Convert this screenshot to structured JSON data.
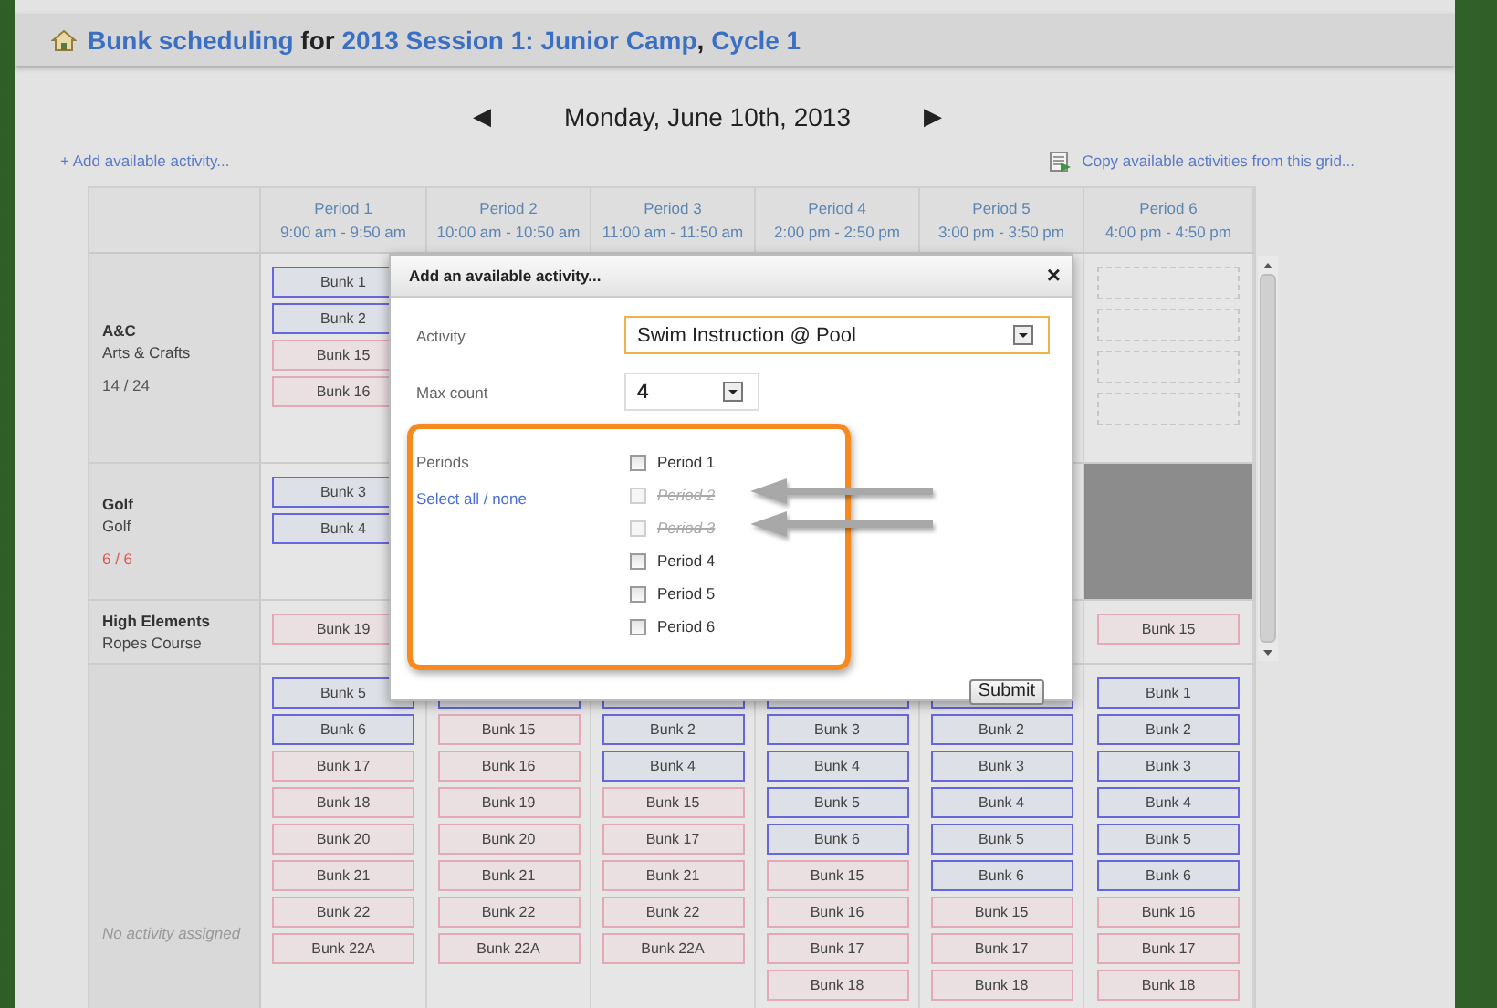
{
  "title": [
    {
      "text": "Bunk scheduling",
      "link": true
    },
    {
      "text": " for ",
      "link": false
    },
    {
      "text": "2013 Session 1: Junior Camp",
      "link": true
    },
    {
      "text": ", ",
      "link": false
    },
    {
      "text": "Cycle 1",
      "link": true
    }
  ],
  "date_nav": {
    "prev": "◀",
    "date": "Monday, June 10th, 2013",
    "next": "▶"
  },
  "add_link": "+ Add available activity...",
  "copy_link": "Copy available activities from this grid...",
  "periods": [
    {
      "name": "Period 1",
      "time": "9:00 am - 9:50 am"
    },
    {
      "name": "Period 2",
      "time": "10:00 am - 10:50 am"
    },
    {
      "name": "Period 3",
      "time": "11:00 am - 11:50 am"
    },
    {
      "name": "Period 4",
      "time": "2:00 pm - 2:50 pm"
    },
    {
      "name": "Period 5",
      "time": "3:00 pm - 3:50 pm"
    },
    {
      "name": "Period 6",
      "time": "4:00 pm - 4:50 pm"
    }
  ],
  "rows": [
    {
      "kind": "activity",
      "name": "A&C",
      "subtitle": "Arts & Crafts",
      "count": "14 / 24",
      "full": false,
      "cells": [
        {
          "blocked": false,
          "bunks": [
            {
              "kind": "assigned",
              "label": "Bunk 1"
            },
            {
              "kind": "assigned",
              "label": "Bunk 2"
            },
            {
              "kind": "available",
              "label": "Bunk 15"
            },
            {
              "kind": "available",
              "label": "Bunk 16"
            }
          ]
        },
        null,
        null,
        null,
        null,
        {
          "blocked": false,
          "bunks": [
            {
              "kind": "empty"
            },
            {
              "kind": "empty"
            },
            {
              "kind": "empty"
            },
            {
              "kind": "empty"
            }
          ]
        }
      ]
    },
    {
      "kind": "activity",
      "name": "Golf",
      "subtitle": "Golf",
      "count": "6 / 6",
      "full": true,
      "cells": [
        {
          "blocked": false,
          "bunks": [
            {
              "kind": "assigned",
              "label": "Bunk 3"
            },
            {
              "kind": "assigned",
              "label": "Bunk 4"
            }
          ]
        },
        null,
        null,
        null,
        null,
        {
          "blocked": true
        }
      ]
    },
    {
      "kind": "activity",
      "name": "High Elements",
      "subtitle": "Ropes Course",
      "cells": [
        {
          "blocked": false,
          "bunks": [
            {
              "kind": "available",
              "label": "Bunk 19"
            }
          ]
        },
        null,
        null,
        null,
        null,
        {
          "blocked": false,
          "bunks": [
            {
              "kind": "available",
              "label": "Bunk 15"
            }
          ]
        }
      ]
    },
    {
      "kind": "unassigned",
      "note": "No activity assigned",
      "cells": [
        {
          "blocked": false,
          "bunks": [
            {
              "kind": "assigned",
              "label": "Bunk 5"
            },
            {
              "kind": "assigned",
              "label": "Bunk 6"
            },
            {
              "kind": "available",
              "label": "Bunk 17"
            },
            {
              "kind": "available",
              "label": "Bunk 18"
            },
            {
              "kind": "available",
              "label": "Bunk 20"
            },
            {
              "kind": "available",
              "label": "Bunk 21"
            },
            {
              "kind": "available",
              "label": "Bunk 22"
            },
            {
              "kind": "available",
              "label": "Bunk 22A"
            }
          ]
        },
        {
          "blocked": false,
          "bunks": [
            {
              "kind": "assigned"
            },
            {
              "kind": "available",
              "label": "Bunk 15"
            },
            {
              "kind": "available",
              "label": "Bunk 16"
            },
            {
              "kind": "available",
              "label": "Bunk 19"
            },
            {
              "kind": "available",
              "label": "Bunk 20"
            },
            {
              "kind": "available",
              "label": "Bunk 21"
            },
            {
              "kind": "available",
              "label": "Bunk 22"
            },
            {
              "kind": "available",
              "label": "Bunk 22A"
            }
          ]
        },
        {
          "blocked": false,
          "bunks": [
            {
              "kind": "assigned"
            },
            {
              "kind": "assigned",
              "label": "Bunk 2"
            },
            {
              "kind": "assigned",
              "label": "Bunk 4"
            },
            {
              "kind": "available",
              "label": "Bunk 15"
            },
            {
              "kind": "available",
              "label": "Bunk 17"
            },
            {
              "kind": "available",
              "label": "Bunk 21"
            },
            {
              "kind": "available",
              "label": "Bunk 22"
            },
            {
              "kind": "available",
              "label": "Bunk 22A"
            }
          ]
        },
        {
          "blocked": false,
          "bunks": [
            {
              "kind": "assigned"
            },
            {
              "kind": "assigned",
              "label": "Bunk 3"
            },
            {
              "kind": "assigned",
              "label": "Bunk 4"
            },
            {
              "kind": "assigned",
              "label": "Bunk 5"
            },
            {
              "kind": "assigned",
              "label": "Bunk 6"
            },
            {
              "kind": "available",
              "label": "Bunk 15"
            },
            {
              "kind": "available",
              "label": "Bunk 16"
            },
            {
              "kind": "available",
              "label": "Bunk 17"
            },
            {
              "kind": "available",
              "label": "Bunk 18"
            }
          ]
        },
        {
          "blocked": false,
          "bunks": [
            {
              "kind": "assigned"
            },
            {
              "kind": "assigned",
              "label": "Bunk 2"
            },
            {
              "kind": "assigned",
              "label": "Bunk 3"
            },
            {
              "kind": "assigned",
              "label": "Bunk 4"
            },
            {
              "kind": "assigned",
              "label": "Bunk 5"
            },
            {
              "kind": "assigned",
              "label": "Bunk 6"
            },
            {
              "kind": "available",
              "label": "Bunk 15"
            },
            {
              "kind": "available",
              "label": "Bunk 17"
            },
            {
              "kind": "available",
              "label": "Bunk 18"
            }
          ]
        },
        {
          "blocked": false,
          "bunks": [
            {
              "kind": "assigned",
              "label": "Bunk 1"
            },
            {
              "kind": "assigned",
              "label": "Bunk 2"
            },
            {
              "kind": "assigned",
              "label": "Bunk 3"
            },
            {
              "kind": "assigned",
              "label": "Bunk 4"
            },
            {
              "kind": "assigned",
              "label": "Bunk 5"
            },
            {
              "kind": "assigned",
              "label": "Bunk 6"
            },
            {
              "kind": "available",
              "label": "Bunk 16"
            },
            {
              "kind": "available",
              "label": "Bunk 17"
            },
            {
              "kind": "available",
              "label": "Bunk 18"
            }
          ]
        }
      ]
    }
  ],
  "dialog": {
    "title": "Add an available activity...",
    "close": "×",
    "activity_label": "Activity",
    "activity_value": "Swim Instruction @ Pool",
    "max_label": "Max count",
    "max_value": "4",
    "periods_label": "Periods",
    "select_all": "Select all / none",
    "periods": [
      {
        "label": "Period 1",
        "checked": false,
        "disabled": false
      },
      {
        "label": "Period 2",
        "checked": false,
        "disabled": true
      },
      {
        "label": "Period 3",
        "checked": false,
        "disabled": true
      },
      {
        "label": "Period 4",
        "checked": false,
        "disabled": false
      },
      {
        "label": "Period 5",
        "checked": false,
        "disabled": false
      },
      {
        "label": "Period 6",
        "checked": false,
        "disabled": false
      }
    ],
    "submit": "Submit"
  }
}
